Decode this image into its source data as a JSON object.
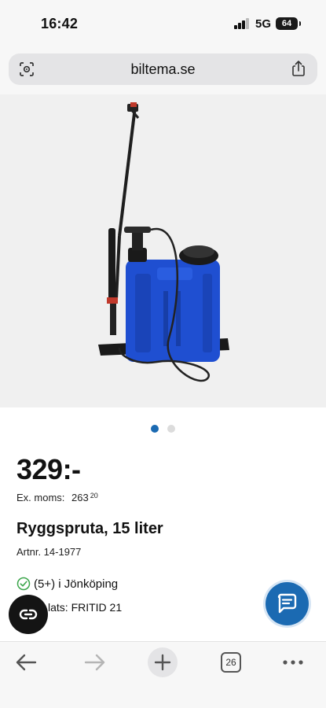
{
  "status_bar": {
    "time": "16:42",
    "network": "5G",
    "battery": "64"
  },
  "browser": {
    "url": "biltema.se",
    "tab_count": "26"
  },
  "product": {
    "price": "329:-",
    "ex_vat_label": "Ex. moms:",
    "ex_vat_whole": "263",
    "ex_vat_cents": "20",
    "title": "Ryggspruta, 15 liter",
    "article_number": "Artnr. 14-1977",
    "stock_text": "(5+) i Jönköping",
    "shelf_text": "lats: FRITID 21"
  },
  "carousel": {
    "total": 2,
    "active": 1
  },
  "colors": {
    "brand_blue": "#1b6ab2",
    "sprayer_blue": "#1f4fd1",
    "stock_green": "#3aa54a"
  },
  "icons": {
    "address_left": "lens-icon",
    "share": "share-icon",
    "stock": "check-circle-icon",
    "chat": "chat-icon",
    "fab": "link-icon",
    "back": "arrow-left-icon",
    "forward": "arrow-right-icon",
    "new_tab": "plus-icon",
    "more": "ellipsis-icon"
  }
}
